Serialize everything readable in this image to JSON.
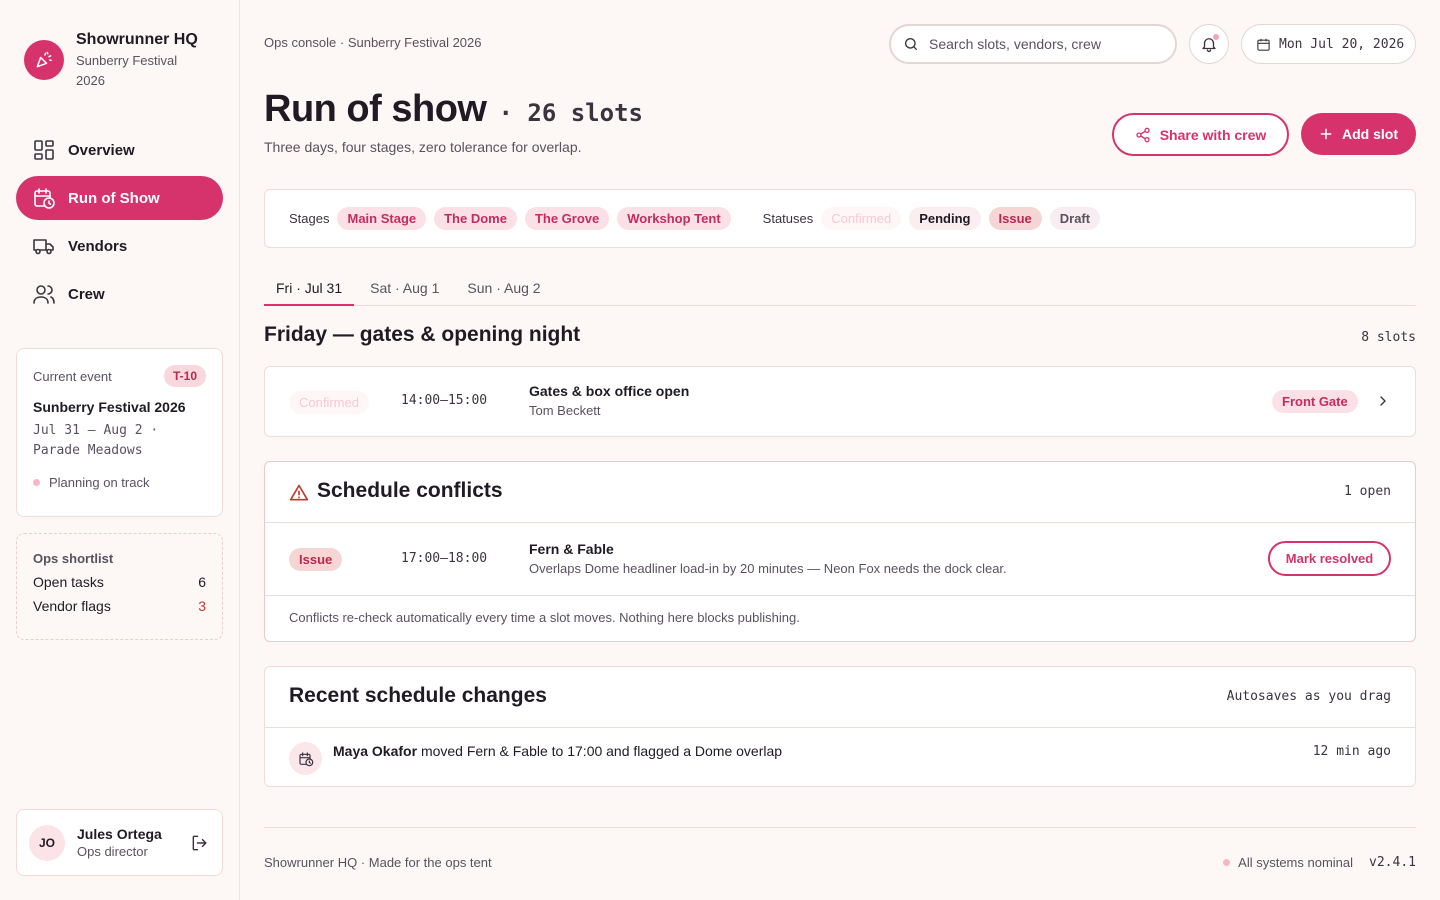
{
  "brand": {
    "name": "Showrunner HQ",
    "subtitle": "Sunberry Festival 2026"
  },
  "nav": [
    {
      "label": "Overview",
      "icon": "grid-icon",
      "active": false
    },
    {
      "label": "Run of Show",
      "icon": "calendar-clock-icon",
      "active": true
    },
    {
      "label": "Vendors",
      "icon": "truck-icon",
      "active": false
    },
    {
      "label": "Crew",
      "icon": "users-icon",
      "active": false
    }
  ],
  "event_card": {
    "label": "Current event",
    "badge": "T-10",
    "title": "Sunberry Festival 2026",
    "dates": "Jul 31 – Aug 2 · Parade Meadows",
    "status": "Planning on track"
  },
  "shortlist": {
    "title": "Ops shortlist",
    "rows": [
      {
        "label": "Open tasks",
        "value": "6"
      },
      {
        "label": "Vendor flags",
        "value": "3"
      }
    ]
  },
  "user": {
    "initials": "JO",
    "name": "Jules Ortega",
    "role": "Ops director"
  },
  "header": {
    "breadcrumb": "Ops console · Sunberry Festival 2026",
    "search_placeholder": "Search slots, vendors, crew",
    "date": "Mon Jul 20, 2026"
  },
  "page": {
    "title": "Run of show",
    "count": "· 26 slots",
    "subtitle": "Three days, four stages, zero tolerance for overlap.",
    "share_label": "Share with crew",
    "add_label": "Add slot"
  },
  "filters": {
    "stages_label": "Stages",
    "stages": [
      "Main Stage",
      "The Dome",
      "The Grove",
      "Workshop Tent"
    ],
    "statuses_label": "Statuses",
    "statuses": [
      "Confirmed",
      "Pending",
      "Issue",
      "Draft"
    ]
  },
  "tabs": [
    {
      "label": "Fri · Jul 31",
      "active": true
    },
    {
      "label": "Sat · Aug 1",
      "active": false
    },
    {
      "label": "Sun · Aug 2",
      "active": false
    }
  ],
  "day": {
    "title": "Friday — gates & opening night",
    "count": "8 slots",
    "slots": [
      {
        "status": "Confirmed",
        "time": "14:00–15:00",
        "title": "Gates & box office open",
        "owner": "Tom Beckett",
        "location": "Front Gate"
      }
    ]
  },
  "conflicts": {
    "title": "Schedule conflicts",
    "open": "1 open",
    "items": [
      {
        "status": "Issue",
        "time": "17:00–18:00",
        "title": "Fern & Fable",
        "detail": "Overlaps Dome headliner load-in by 20 minutes — Neon Fox needs the dock clear.",
        "action": "Mark resolved"
      }
    ],
    "note": "Conflicts re-check automatically every time a slot moves. Nothing here blocks publishing."
  },
  "changes": {
    "title": "Recent schedule changes",
    "meta": "Autosaves as you drag",
    "items": [
      {
        "actor": "Maya Okafor",
        "text": "moved Fern & Fable to 17:00 and flagged a Dome overlap",
        "time": "12 min ago"
      }
    ]
  },
  "footer": {
    "left": "Showrunner HQ · Made for the ops tent",
    "status": "All systems nominal",
    "version": "v2.4.1"
  },
  "colors": {
    "accent": "#d6336c",
    "accent_soft": "#fbe0e7",
    "background": "#fdf8f5",
    "issue": "#b8284f"
  }
}
